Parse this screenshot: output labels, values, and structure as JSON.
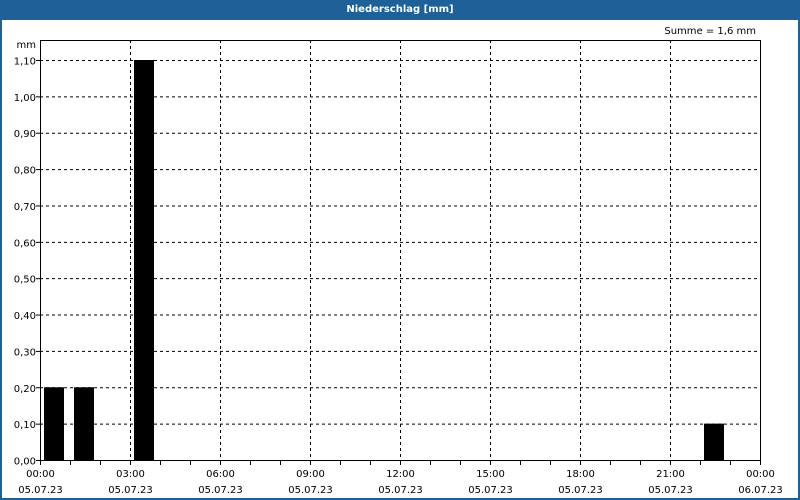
{
  "window": {
    "title": "Niederschlag [mm]"
  },
  "chart_data": {
    "type": "bar",
    "title": "Niederschlag [mm]",
    "ylabel": "mm",
    "sum_label": "Summe = 1,6 mm",
    "ylim": [
      0,
      1.1
    ],
    "yticks": [
      "0,00",
      "0,10",
      "0,20",
      "0,30",
      "0,40",
      "0,50",
      "0,60",
      "0,70",
      "0,80",
      "0,90",
      "1,00",
      "1,10"
    ],
    "xrange_hours": [
      0,
      24
    ],
    "xticks": [
      {
        "time": "00:00",
        "date": "05.07.23"
      },
      {
        "time": "03:00",
        "date": "05.07.23"
      },
      {
        "time": "06:00",
        "date": "05.07.23"
      },
      {
        "time": "09:00",
        "date": "05.07.23"
      },
      {
        "time": "12:00",
        "date": "05.07.23"
      },
      {
        "time": "15:00",
        "date": "05.07.23"
      },
      {
        "time": "18:00",
        "date": "05.07.23"
      },
      {
        "time": "21:00",
        "date": "05.07.23"
      },
      {
        "time": "00:00",
        "date": "06.07.23"
      }
    ],
    "bars": [
      {
        "hour_start": 0,
        "value": 0.2
      },
      {
        "hour_start": 1,
        "value": 0.2
      },
      {
        "hour_start": 3,
        "value": 1.1
      },
      {
        "hour_start": 22,
        "value": 0.1
      }
    ],
    "grid": true,
    "bar_color": "#000000"
  }
}
